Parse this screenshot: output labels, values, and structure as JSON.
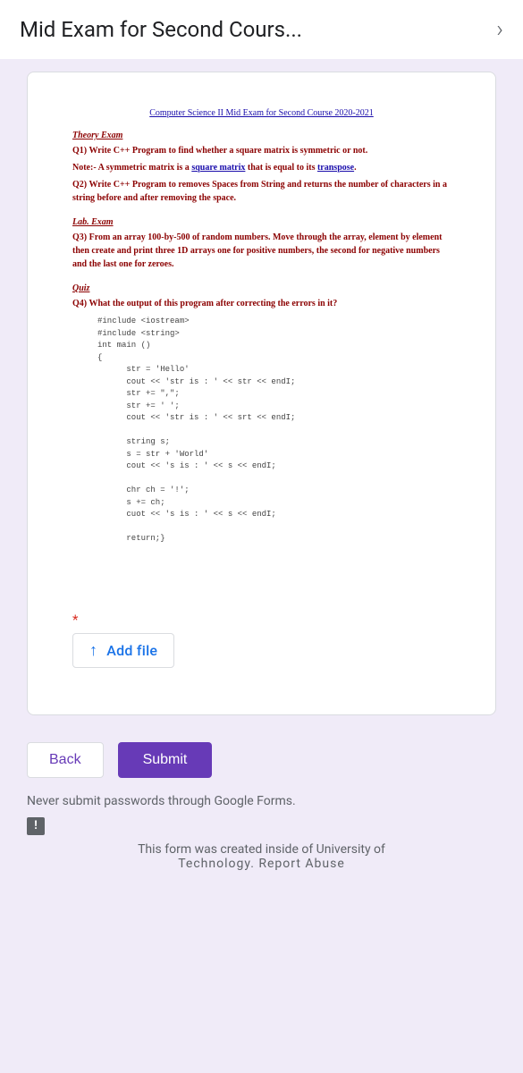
{
  "header": {
    "title": "Mid Exam for Second Cours..."
  },
  "exam": {
    "doc_title": "Computer Science II Mid Exam for Second Course 2020-2021",
    "theory_title": "Theory Exam",
    "q1_label": "Q1)",
    "q1_text": "Write C++ Program to find whether a square matrix is symmetric or not.",
    "q1_note_label": "Note:-",
    "q1_note_text": "A symmetric matrix is a ",
    "q1_note_link1": "square matrix",
    "q1_note_mid": " that is equal to its ",
    "q1_note_link2": "transpose",
    "q1_note_end": ".",
    "q2_label": "Q2)",
    "q2_text": "Write C++ Program to removes Spaces from String and returns the number of characters in a string before and after removing the space.",
    "lab_title": "Lab. Exam",
    "q3_label": "Q3)",
    "q3_text": "From an array 100-by-500 of random numbers. Move through the array, element by element then create and print three 1D arrays one for positive numbers, the second for negative numbers and the last one for zeroes.",
    "quiz_title": "Quiz",
    "q4_label": "Q4)",
    "q4_text": "What the output of this program after correcting the errors in it?",
    "code": {
      "l1": "#include <iostream>",
      "l2": "#include <string>",
      "l3": "int main ()",
      "l4": "{",
      "l5": "str = 'Hello'",
      "l6": "cout << 'str is : ' << str << endI;",
      "l7": "str += \",\";",
      "l8": "str += ' ';",
      "l9": "cout << 'str is : ' << srt << endI;",
      "l10": "string s;",
      "l11": "s = str + 'World'",
      "l12": "cout << 's is : ' << s << endI;",
      "l13": "chr ch = '!';",
      "l14": "s += ch;",
      "l15": "cuot << 's is : ' << s << endI;",
      "l16": "return;}"
    }
  },
  "form": {
    "required": "*",
    "add_file": "Add file",
    "back": "Back",
    "submit": "Submit",
    "warning": "Never submit passwords through Google Forms.",
    "created": "This form was created inside of University of",
    "cutoff": "Technology. Report Abuse"
  }
}
